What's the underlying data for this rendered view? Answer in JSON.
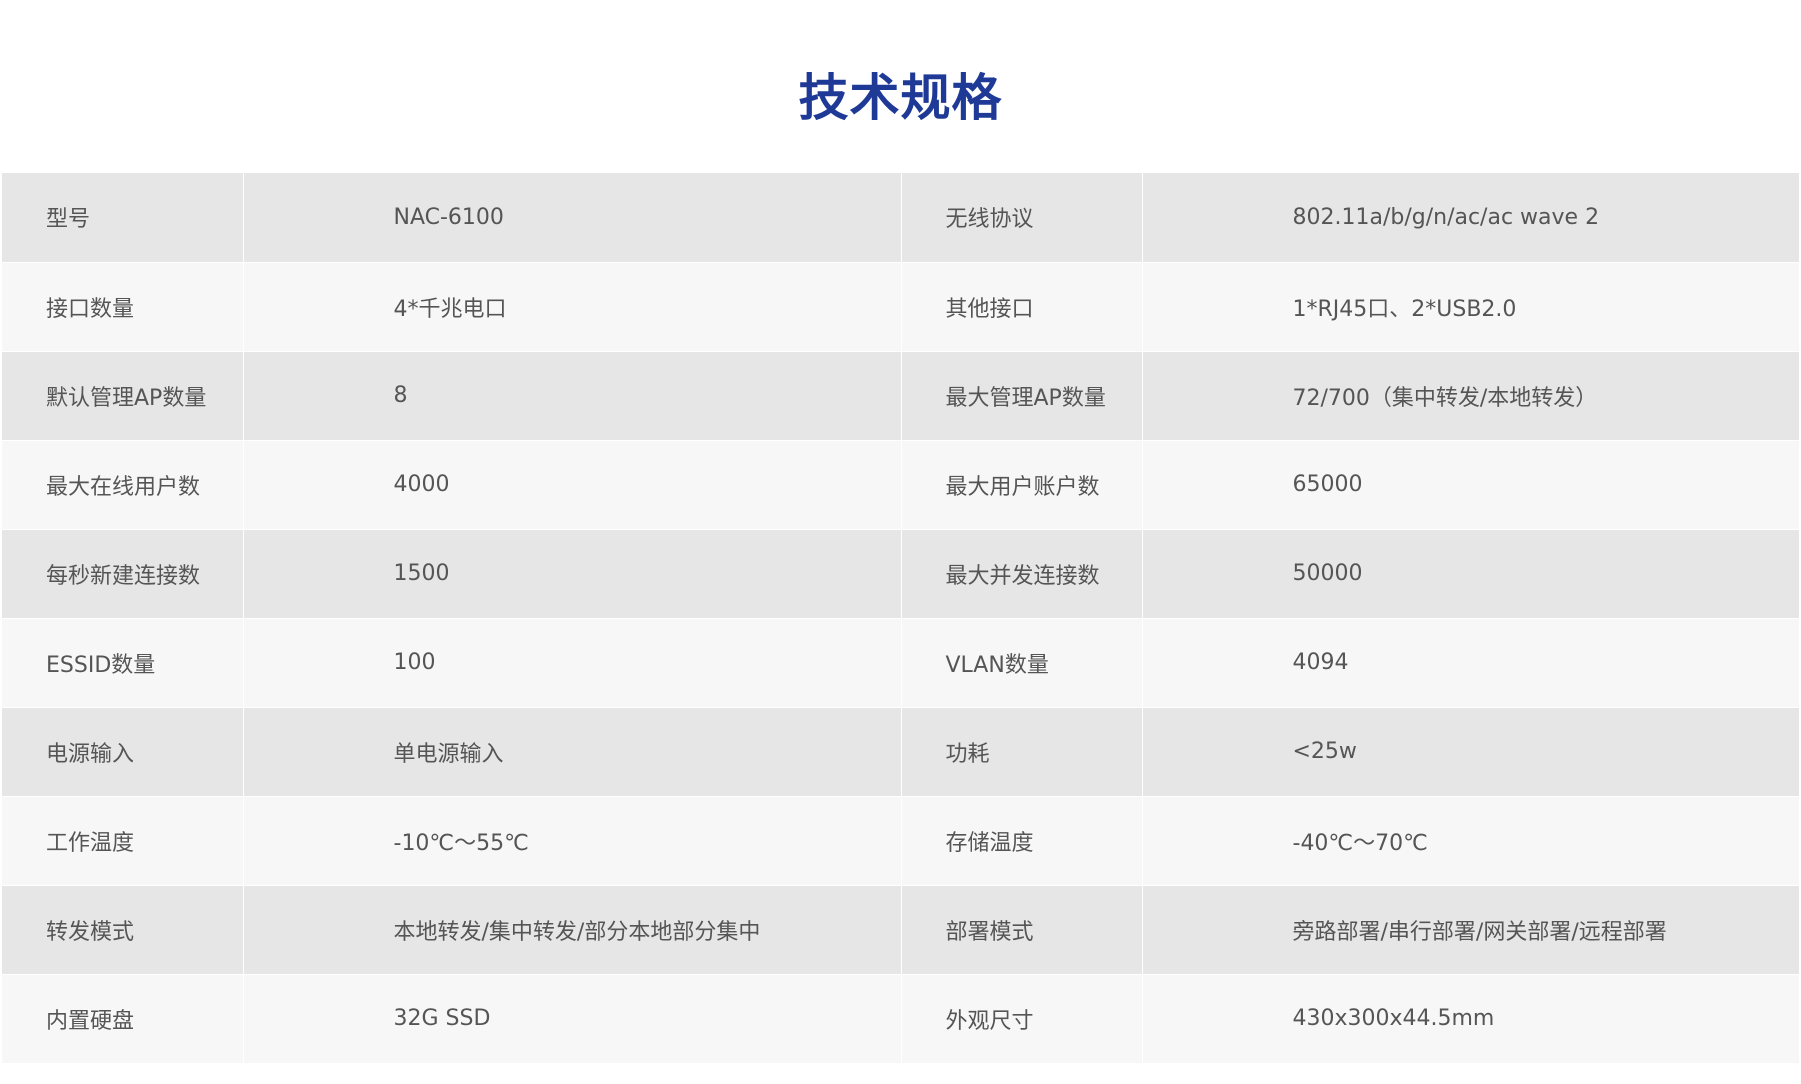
{
  "title": "技术规格",
  "specs": [
    {
      "label1": "型号",
      "value1": "NAC-6100",
      "label2": "无线协议",
      "value2": "802.11a/b/g/n/ac/ac wave 2"
    },
    {
      "label1": "接口数量",
      "value1": "4*千兆电口",
      "label2": "其他接口",
      "value2": "1*RJ45口、2*USB2.0"
    },
    {
      "label1": "默认管理AP数量",
      "value1": "8",
      "label2": "最大管理AP数量",
      "value2": "72/700（集中转发/本地转发）"
    },
    {
      "label1": "最大在线用户数",
      "value1": "4000",
      "label2": "最大用户账户数",
      "value2": "65000"
    },
    {
      "label1": "每秒新建连接数",
      "value1": "1500",
      "label2": "最大并发连接数",
      "value2": "50000"
    },
    {
      "label1": "ESSID数量",
      "value1": "100",
      "label2": "VLAN数量",
      "value2": "4094"
    },
    {
      "label1": "电源输入",
      "value1": "单电源输入",
      "label2": "功耗",
      "value2": "<25w"
    },
    {
      "label1": "工作温度",
      "value1": "-10℃～55℃",
      "label2": "存储温度",
      "value2": "-40℃～70℃"
    },
    {
      "label1": "转发模式",
      "value1": "本地转发/集中转发/部分本地部分集中",
      "label2": "部署模式",
      "value2": "旁路部署/串行部署/网关部署/远程部署"
    },
    {
      "label1": "内置硬盘",
      "value1": "32G SSD",
      "label2": "外观尺寸",
      "value2": "430x300x44.5mm"
    }
  ],
  "colors": {
    "title": "#1e3a96",
    "row_odd": "#e6e6e6",
    "row_even": "#f7f7f7",
    "text": "#555555"
  }
}
